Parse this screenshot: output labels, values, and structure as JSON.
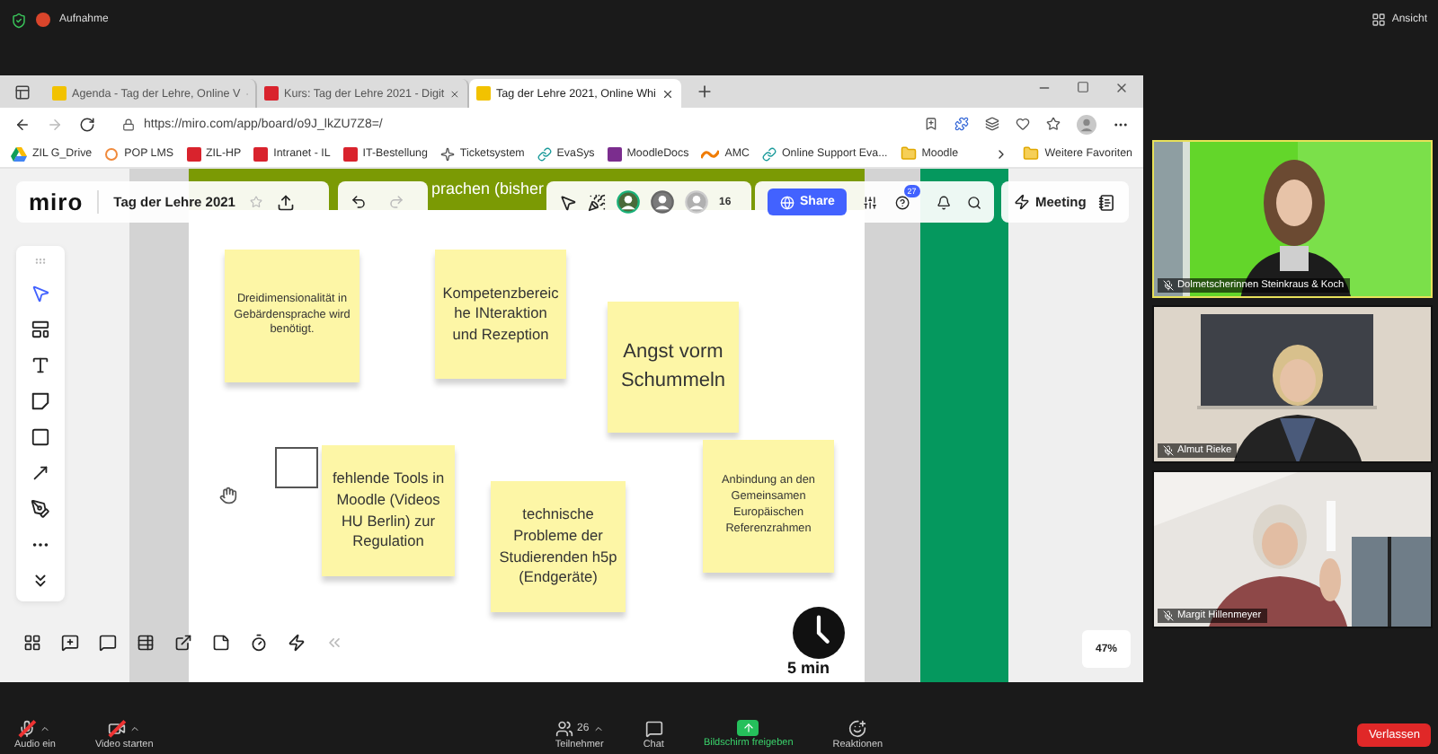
{
  "zoom_top": {
    "recording": "Aufnahme",
    "view": "Ansicht"
  },
  "browser": {
    "tabs": [
      {
        "label": "Agenda - Tag der Lehre, Online V",
        "selected": false
      },
      {
        "label": "Kurs: Tag der Lehre 2021 - Digit",
        "selected": false
      },
      {
        "label": "Tag der Lehre 2021, Online Whi",
        "selected": true
      }
    ],
    "url": "https://miro.com/app/board/o9J_lkZU7Z8=/",
    "bookmarks": [
      {
        "label": "ZIL G_Drive"
      },
      {
        "label": "POP LMS"
      },
      {
        "label": "ZIL-HP"
      },
      {
        "label": "Intranet - IL"
      },
      {
        "label": "IT-Bestellung"
      },
      {
        "label": "Ticketsystem"
      },
      {
        "label": "EvaSys"
      },
      {
        "label": "MoodleDocs"
      },
      {
        "label": "AMC"
      },
      {
        "label": "Online Support Eva..."
      },
      {
        "label": "Moodle"
      }
    ],
    "other_favorites": "Weitere Favoriten"
  },
  "miro": {
    "logo": "miro",
    "board_title": "Tag der Lehre 2021",
    "frame_title": "prachen (bisher",
    "collaborator_count": "16",
    "share": "Share",
    "help_badge": "27",
    "meeting": "Meeting",
    "tools": [
      {
        "kind": "select",
        "selected": true
      },
      {
        "kind": "templates",
        "selected": false
      },
      {
        "kind": "text",
        "selected": false
      },
      {
        "kind": "sticky",
        "selected": false
      },
      {
        "kind": "shape",
        "selected": false
      },
      {
        "kind": "line",
        "selected": false
      },
      {
        "kind": "pen",
        "selected": false
      },
      {
        "kind": "more",
        "selected": false
      },
      {
        "kind": "collapse",
        "selected": false
      }
    ],
    "stickies": [
      {
        "text": "Dreidimensionalität in Gebärdensprache wird benötigt."
      },
      {
        "text": "Kompetenzbereiche INteraktion und Rezeption"
      },
      {
        "text": "Angst vorm Schummeln"
      },
      {
        "text": "fehlende Tools in Moodle (Videos HU Berlin) zur Regulation"
      },
      {
        "text": "technische Probleme der Studierenden h5p (Endgeräte)"
      },
      {
        "text": "Anbindung an den Gemeinsamen Europäischen Referenzrahmen"
      }
    ],
    "timer": "5 min",
    "zoom_level": "47%"
  },
  "participants": [
    {
      "name": "Dolmetscherinnen Steinkraus & Koch",
      "speaking": true
    },
    {
      "name": "Almut Rieke",
      "speaking": false
    },
    {
      "name": "Margit Hillenmeyer",
      "speaking": false
    }
  ],
  "toolbar": {
    "items": [
      {
        "label": "Audio ein",
        "kind": "audio",
        "off": true
      },
      {
        "label": "Video starten",
        "kind": "video",
        "off": true
      },
      {
        "label": "Teilnehmer",
        "kind": "participants",
        "off": false,
        "count": "26"
      },
      {
        "label": "Chat",
        "kind": "chat",
        "off": false
      },
      {
        "label": "Bildschirm freigeben",
        "kind": "share",
        "off": false
      },
      {
        "label": "Reaktionen",
        "kind": "reactions",
        "off": false
      }
    ],
    "leave": "Verlassen"
  }
}
